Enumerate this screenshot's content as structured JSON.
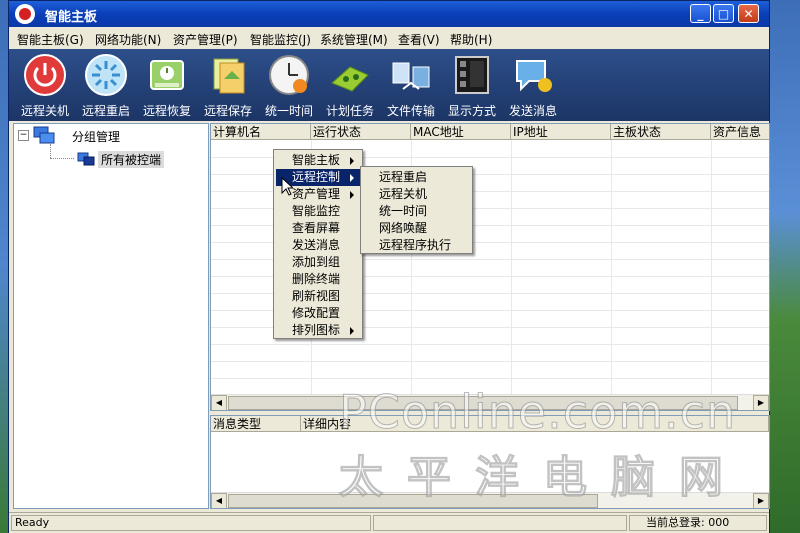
{
  "window": {
    "title": "智能主板"
  },
  "menubar": [
    "智能主板(G)",
    "网络功能(N)",
    "资产管理(P)",
    "智能监控(J)",
    "系统管理(M)",
    "查看(V)",
    "帮助(H)"
  ],
  "toolbar": [
    {
      "label": "远程关机",
      "icon": "power-icon"
    },
    {
      "label": "远程重启",
      "icon": "restart-icon"
    },
    {
      "label": "远程恢复",
      "icon": "restore-icon"
    },
    {
      "label": "远程保存",
      "icon": "save-icon"
    },
    {
      "label": "统一时间",
      "icon": "clock-icon"
    },
    {
      "label": "计划任务",
      "icon": "schedule-icon"
    },
    {
      "label": "文件传输",
      "icon": "transfer-icon"
    },
    {
      "label": "显示方式",
      "icon": "display-icon"
    },
    {
      "label": "发送消息",
      "icon": "message-icon"
    }
  ],
  "tree": {
    "root": "分组管理",
    "child": "所有被控端"
  },
  "list_columns": [
    "计算机名",
    "运行状态",
    "MAC地址",
    "IP地址",
    "主板状态",
    "资产信息"
  ],
  "message_columns": [
    "消息类型",
    "详细内容"
  ],
  "context_menu": [
    "智能主板",
    "远程控制",
    "资产管理",
    "智能监控",
    "查看屏幕",
    "发送消息",
    "添加到组",
    "删除终端",
    "刷新视图",
    "修改配置",
    "排列图标"
  ],
  "submenu": [
    "远程重启",
    "远程关机",
    "统一时间",
    "网络唤醒",
    "远程程序执行"
  ],
  "status": {
    "left": "Ready",
    "right": "当前总登录: 000"
  },
  "watermark": {
    "line1": "PConline.com.cn",
    "line2": "太平洋电脑网"
  }
}
